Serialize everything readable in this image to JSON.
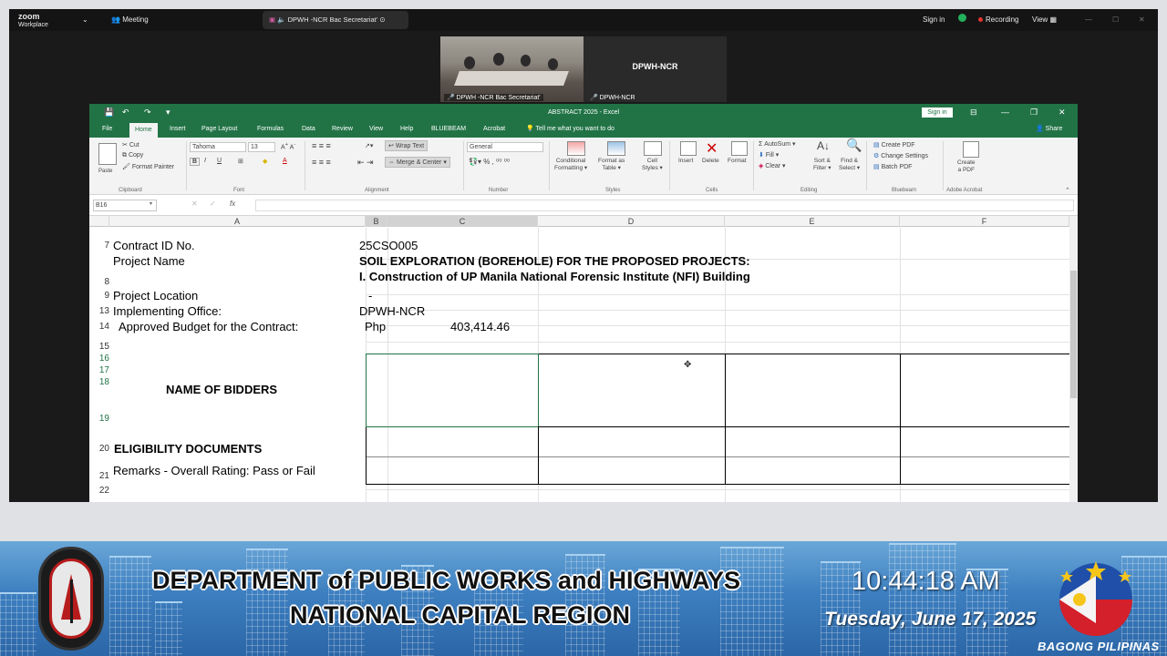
{
  "zoom_bar": {
    "brand_top": "zoom",
    "brand_bottom": "Workplace",
    "meeting_label": "Meeting",
    "tab_title": "DPWH -NCR Bac Secretariat'",
    "sign_in": "Sign in",
    "recording": "Recording",
    "view": "View"
  },
  "gallery": {
    "video_name": "DPWH -NCR Bac Secretariat'",
    "tile_title": "DPWH-NCR",
    "tile_name": "DPWH-NCR"
  },
  "excel": {
    "window_title": "ABSTRACT 2025  -  Excel",
    "sign_in": "Sign in",
    "share": "Share",
    "tabs": [
      "File",
      "Home",
      "Insert",
      "Page Layout",
      "Formulas",
      "Data",
      "Review",
      "View",
      "Help",
      "BLUEBEAM",
      "Acrobat"
    ],
    "tell_me": "Tell me what you want to do",
    "ribbon": {
      "clipboard": {
        "paste": "Paste",
        "cut": "Cut",
        "copy": "Copy",
        "format_painter": "Format Painter",
        "label": "Clipboard"
      },
      "font": {
        "name": "Tahoma",
        "size": "13",
        "label": "Font"
      },
      "alignment": {
        "wrap": "Wrap Text",
        "merge": "Merge & Center",
        "label": "Alignment"
      },
      "number": {
        "format": "General",
        "label": "Number"
      },
      "styles": {
        "conditional": [
          "Conditional",
          "Formatting"
        ],
        "table": [
          "Format as",
          "Table"
        ],
        "cell": [
          "Cell",
          "Styles"
        ],
        "label": "Styles"
      },
      "cells": {
        "insert": "Insert",
        "delete": "Delete",
        "format": "Format",
        "label": "Cells"
      },
      "editing": {
        "autosum": "AutoSum",
        "fill": "Fill",
        "clear": "Clear",
        "sort": [
          "Sort &",
          "Filter"
        ],
        "find": [
          "Find &",
          "Select"
        ],
        "label": "Editing"
      },
      "bluebeam": {
        "items": [
          "Create PDF",
          "Change Settings",
          "Batch PDF"
        ],
        "label": "Bluebeam"
      },
      "acrobat": {
        "create": [
          "Create",
          "a PDF"
        ],
        "label": "Adobe Acrobat"
      }
    },
    "name_box": "B16",
    "fx": "fx",
    "columns": [
      "A",
      "B",
      "C",
      "D",
      "E",
      "F"
    ],
    "rows": {
      "r7": {
        "num": "7",
        "label": "Contract ID No.",
        "value": "25CSO005"
      },
      "r8": {
        "num": "8",
        "label": "Project Name",
        "line1": "SOIL EXPLORATION (BOREHOLE) FOR THE PROPOSED PROJECTS:",
        "line2": "I. Construction of UP Manila National Forensic Institute (NFI) Building"
      },
      "r9": {
        "num": "9",
        "label": "Project Location",
        "value": "-"
      },
      "r13": {
        "num": "13",
        "label": "Implementing Office:",
        "value": "DPWH-NCR"
      },
      "r14": {
        "num": "14",
        "label": "Approved Budget for the Contract:",
        "currency": "Php",
        "amount": "403,414.46"
      },
      "r15": {
        "num": "15"
      },
      "r16": {
        "num": "16"
      },
      "r17": {
        "num": "17"
      },
      "r18": {
        "num": "18"
      },
      "r19": {
        "num": "19",
        "label": "NAME OF BIDDERS"
      },
      "r20": {
        "num": "20",
        "label": "ELIGIBILITY DOCUMENTS"
      },
      "r21": {
        "num": "21",
        "label": "Remarks - Overall Rating: Pass or Fail"
      },
      "r22": {
        "num": "22"
      }
    }
  },
  "banner": {
    "line1": "DEPARTMENT of PUBLIC WORKS and HIGHWAYS",
    "line2": "NATIONAL CAPITAL REGION",
    "time": "10:44:18 AM",
    "date": "Tuesday, June 17, 2025",
    "slogan": "BAGONG PILIPINAS"
  },
  "colors": {
    "excel_green": "#217346",
    "zoom_bg": "#1a1a1a",
    "banner_blue": "#3d7fc0"
  }
}
